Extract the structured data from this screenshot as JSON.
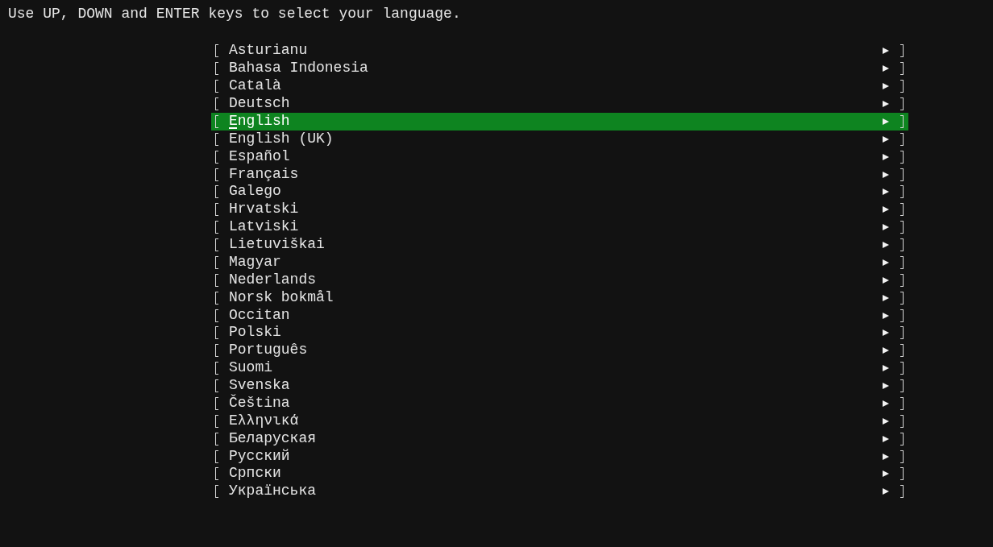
{
  "instruction": "Use UP, DOWN and ENTER keys to select your language.",
  "languages": [
    {
      "label": "Asturianu",
      "selected": false
    },
    {
      "label": "Bahasa Indonesia",
      "selected": false
    },
    {
      "label": "Català",
      "selected": false
    },
    {
      "label": "Deutsch",
      "selected": false
    },
    {
      "label": "English",
      "selected": true
    },
    {
      "label": "English (UK)",
      "selected": false
    },
    {
      "label": "Español",
      "selected": false
    },
    {
      "label": "Français",
      "selected": false
    },
    {
      "label": "Galego",
      "selected": false
    },
    {
      "label": "Hrvatski",
      "selected": false
    },
    {
      "label": "Latviski",
      "selected": false
    },
    {
      "label": "Lietuviškai",
      "selected": false
    },
    {
      "label": "Magyar",
      "selected": false
    },
    {
      "label": "Nederlands",
      "selected": false
    },
    {
      "label": "Norsk bokmål",
      "selected": false
    },
    {
      "label": "Occitan",
      "selected": false
    },
    {
      "label": "Polski",
      "selected": false
    },
    {
      "label": "Português",
      "selected": false
    },
    {
      "label": "Suomi",
      "selected": false
    },
    {
      "label": "Svenska",
      "selected": false
    },
    {
      "label": "Čeština",
      "selected": false
    },
    {
      "label": "Ελληνικά",
      "selected": false
    },
    {
      "label": "Беларуская",
      "selected": false
    },
    {
      "label": "Русский",
      "selected": false
    },
    {
      "label": "Српски",
      "selected": false
    },
    {
      "label": "Українська",
      "selected": false
    }
  ]
}
